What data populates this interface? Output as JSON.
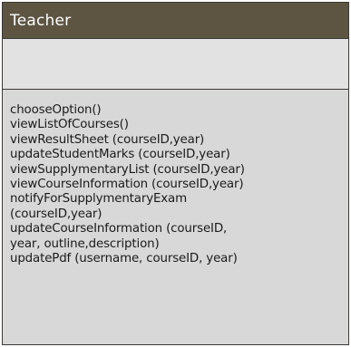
{
  "class_box": {
    "name": "Teacher",
    "attributes": [],
    "methods": [
      "chooseOption()",
      "viewListOfCourses()",
      "viewResultSheet (courseID,year)",
      "updateStudentMarks (courseID,year)",
      "viewSupplymentaryList (courseID,year)",
      "viewCourseInformation (courseID,year)",
      "notifyForSupplymentaryExam",
      "(courseID,year)",
      "updateCourseInformation (courseID,",
      "year, outline,description)",
      "updatePdf (username, courseID, year)"
    ]
  },
  "colors": {
    "header_fill": "#5d5442",
    "header_text": "#ffffff",
    "body_fill": "#d8d8d8",
    "border": "#3b3a36"
  }
}
